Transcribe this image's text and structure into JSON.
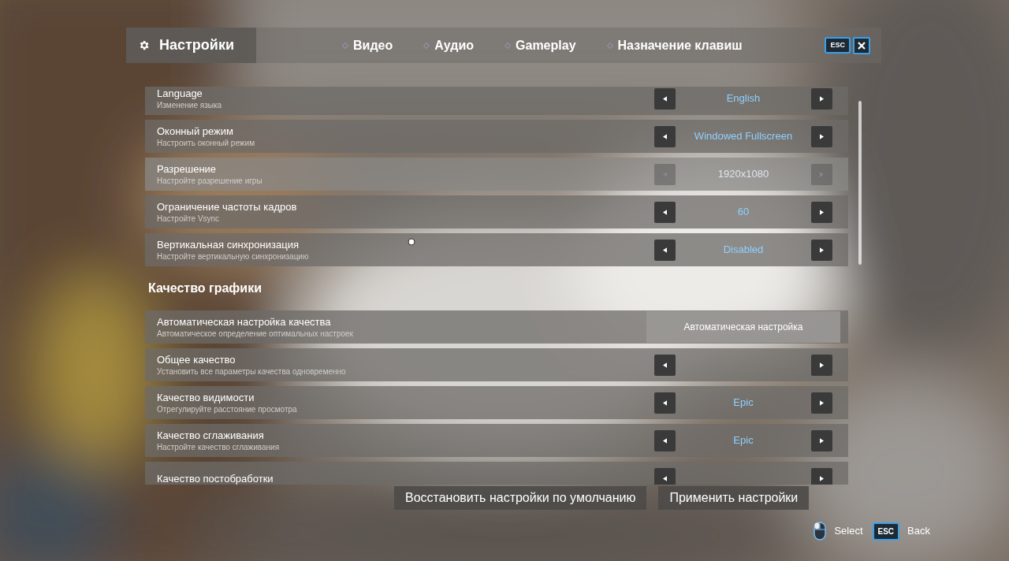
{
  "header": {
    "title": "Настройки",
    "tabs": [
      {
        "label": "Видео"
      },
      {
        "label": "Аудио"
      },
      {
        "label": "Gameplay"
      },
      {
        "label": "Назначение клавиш"
      }
    ],
    "esc_key": "ESC"
  },
  "settings": [
    {
      "kind": "selector",
      "label": "Language",
      "description": "Изменение языка",
      "value": "English",
      "disabled": false
    },
    {
      "kind": "selector",
      "label": "Оконный режим",
      "description": "Настроить оконный режим",
      "value": "Windowed Fullscreen",
      "disabled": false
    },
    {
      "kind": "selector",
      "label": "Разрешение",
      "description": "Настройте разрешение игры",
      "value": "1920x1080",
      "disabled": true
    },
    {
      "kind": "selector",
      "label": "Ограничение частоты кадров",
      "description": "Настройте Vsync",
      "value": "60",
      "disabled": false
    },
    {
      "kind": "selector",
      "label": "Вертикальная синхронизация",
      "description": "Настройте вертикальную синхронизацию",
      "value": "Disabled",
      "disabled": false
    },
    {
      "kind": "heading",
      "label": "Качество графики"
    },
    {
      "kind": "button",
      "label": "Автоматическая настройка качества",
      "description": "Автоматическое определение оптимальных настроек",
      "button_label": "Автоматическая настройка",
      "disabled": false
    },
    {
      "kind": "selector",
      "label": "Общее качество",
      "description": "Установить все параметры качества одновременно",
      "disabled": false
    },
    {
      "kind": "selector",
      "label": "Качество видимости",
      "description": "Отрегулируйте расстояние просмотра",
      "value": "Epic",
      "disabled": false
    },
    {
      "kind": "selector",
      "label": "Качество сглаживания",
      "description": "Настройте качество сглаживания",
      "value": "Epic",
      "disabled": false
    },
    {
      "kind": "selector",
      "label": "Качество постобработки",
      "disabled": false
    }
  ],
  "footer_buttons": [
    "Восстановить настройки по умолчанию",
    "Применить настройки"
  ],
  "hints": [
    {
      "kind": "mouse",
      "label": "Select"
    },
    {
      "kind": "key",
      "key": "ESC",
      "label": "Back"
    }
  ]
}
